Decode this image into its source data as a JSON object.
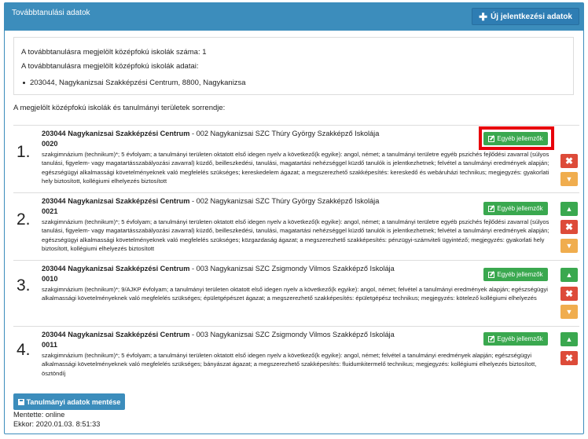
{
  "header": {
    "title": "Továbbtanulási adatok",
    "new_button": "Új jelentkezési adatok"
  },
  "info": {
    "count_line": "A továbbtanulásra megjelölt középfokú iskolák száma: 1",
    "data_line": "A továbbtanulásra megjelölt középfokú iskolák adatai:",
    "school": "203044, Nagykanizsai Szakképzési Centrum, 8800, Nagykanizsa"
  },
  "order_label": "A megjelölt középfokú iskolák és tanulmányi területek sorrendje:",
  "egyeb_label": "Egyéb jellemzők",
  "items": [
    {
      "num": "1.",
      "school": "203044 Nagykanizsai Szakképzési Centrum",
      "institution": " - 002 Nagykanizsai SZC Thúry György Szakképző Iskolája",
      "code": "0020",
      "desc": "szakgimnázium (technikum)*; 5 évfolyam; a tanulmányi területen oktatott első idegen nyelv a következő(k egyike): angol, német; a tanulmányi területre egyéb pszichés fejlődési zavarral (súlyos tanulási, figyelem- vagy magatartásszabályozási zavarral) küzdő, beilleszkedési, tanulási, magatartási nehézséggel küzdő tanulók is jelentkezhetnek; felvétel a tanulmányi eredmények alapján; egészségügyi alkalmassági követelményeknek való megfelelés szükséges; kereskedelem ágazat; a megszerezhető szakképesítés: kereskedő és webáruházi technikus; megjegyzés: gyakorlati hely biztosított, kollégiumi elhelyezés biztosított"
    },
    {
      "num": "2.",
      "school": "203044 Nagykanizsai Szakképzési Centrum",
      "institution": " - 002 Nagykanizsai SZC Thúry György Szakképző Iskolája",
      "code": "0021",
      "desc": "szakgimnázium (technikum)*; 5 évfolyam; a tanulmányi területen oktatott első idegen nyelv a következő(k egyike): angol, német; a tanulmányi területre egyéb pszichés fejlődési zavarral (súlyos tanulási, figyelem- vagy magatartásszabályozási zavarral) küzdő, beilleszkedési, tanulási, magatartási nehézséggel küzdő tanulók is jelentkezhetnek; felvétel a tanulmányi eredmények alapján; egészségügyi alkalmassági követelményeknek való megfelelés szükséges; közgazdaság ágazat; a megszerezhető szakképesítés: pénzügyi-számviteli ügyintéző; megjegyzés: gyakorlati hely biztosított, kollégiumi elhelyezés biztosított"
    },
    {
      "num": "3.",
      "school": "203044 Nagykanizsai Szakképzési Centrum",
      "institution": " - 003 Nagykanizsai SZC Zsigmondy Vilmos Szakképző Iskolája",
      "code": "0010",
      "desc": "szakgimnázium (technikum)*; 9/AJKP évfolyam; a tanulmányi területen oktatott első idegen nyelv a következő(k egyike): angol, német; felvétel a tanulmányi eredmények alapján; egészségügyi alkalmassági követelményeknek való megfelelés szükséges; épületgépészet ágazat; a megszerezhető szakképesítés: épületgépész technikus; megjegyzés: kötelező kollégiumi elhelyezés"
    },
    {
      "num": "4.",
      "school": "203044 Nagykanizsai Szakképzési Centrum",
      "institution": " - 003 Nagykanizsai SZC Zsigmondy Vilmos Szakképző Iskolája",
      "code": "0011",
      "desc": "szakgimnázium (technikum)*; 5 évfolyam; a tanulmányi területen oktatott első idegen nyelv a következő(k egyike): angol, német; felvétel a tanulmányi eredmények alapján; egészségügyi alkalmassági követelményeknek való megfelelés szükséges; bányászat ágazat; a megszerezhető szakképesítés: fluidumkitermelő technikus; megjegyzés: kollégiumi elhelyezés biztosított, ösztöndíj"
    }
  ],
  "save_button": "Tanulmányi adatok mentése",
  "saved_by": "Mentette: online",
  "saved_at": "Ekkor: 2020.01.03. 8:51:33",
  "colors": {
    "primary": "#3c8dbc",
    "success": "#3aa84f",
    "danger": "#dd4b39",
    "warning": "#f0ad4e",
    "highlight": "#e8000b"
  }
}
